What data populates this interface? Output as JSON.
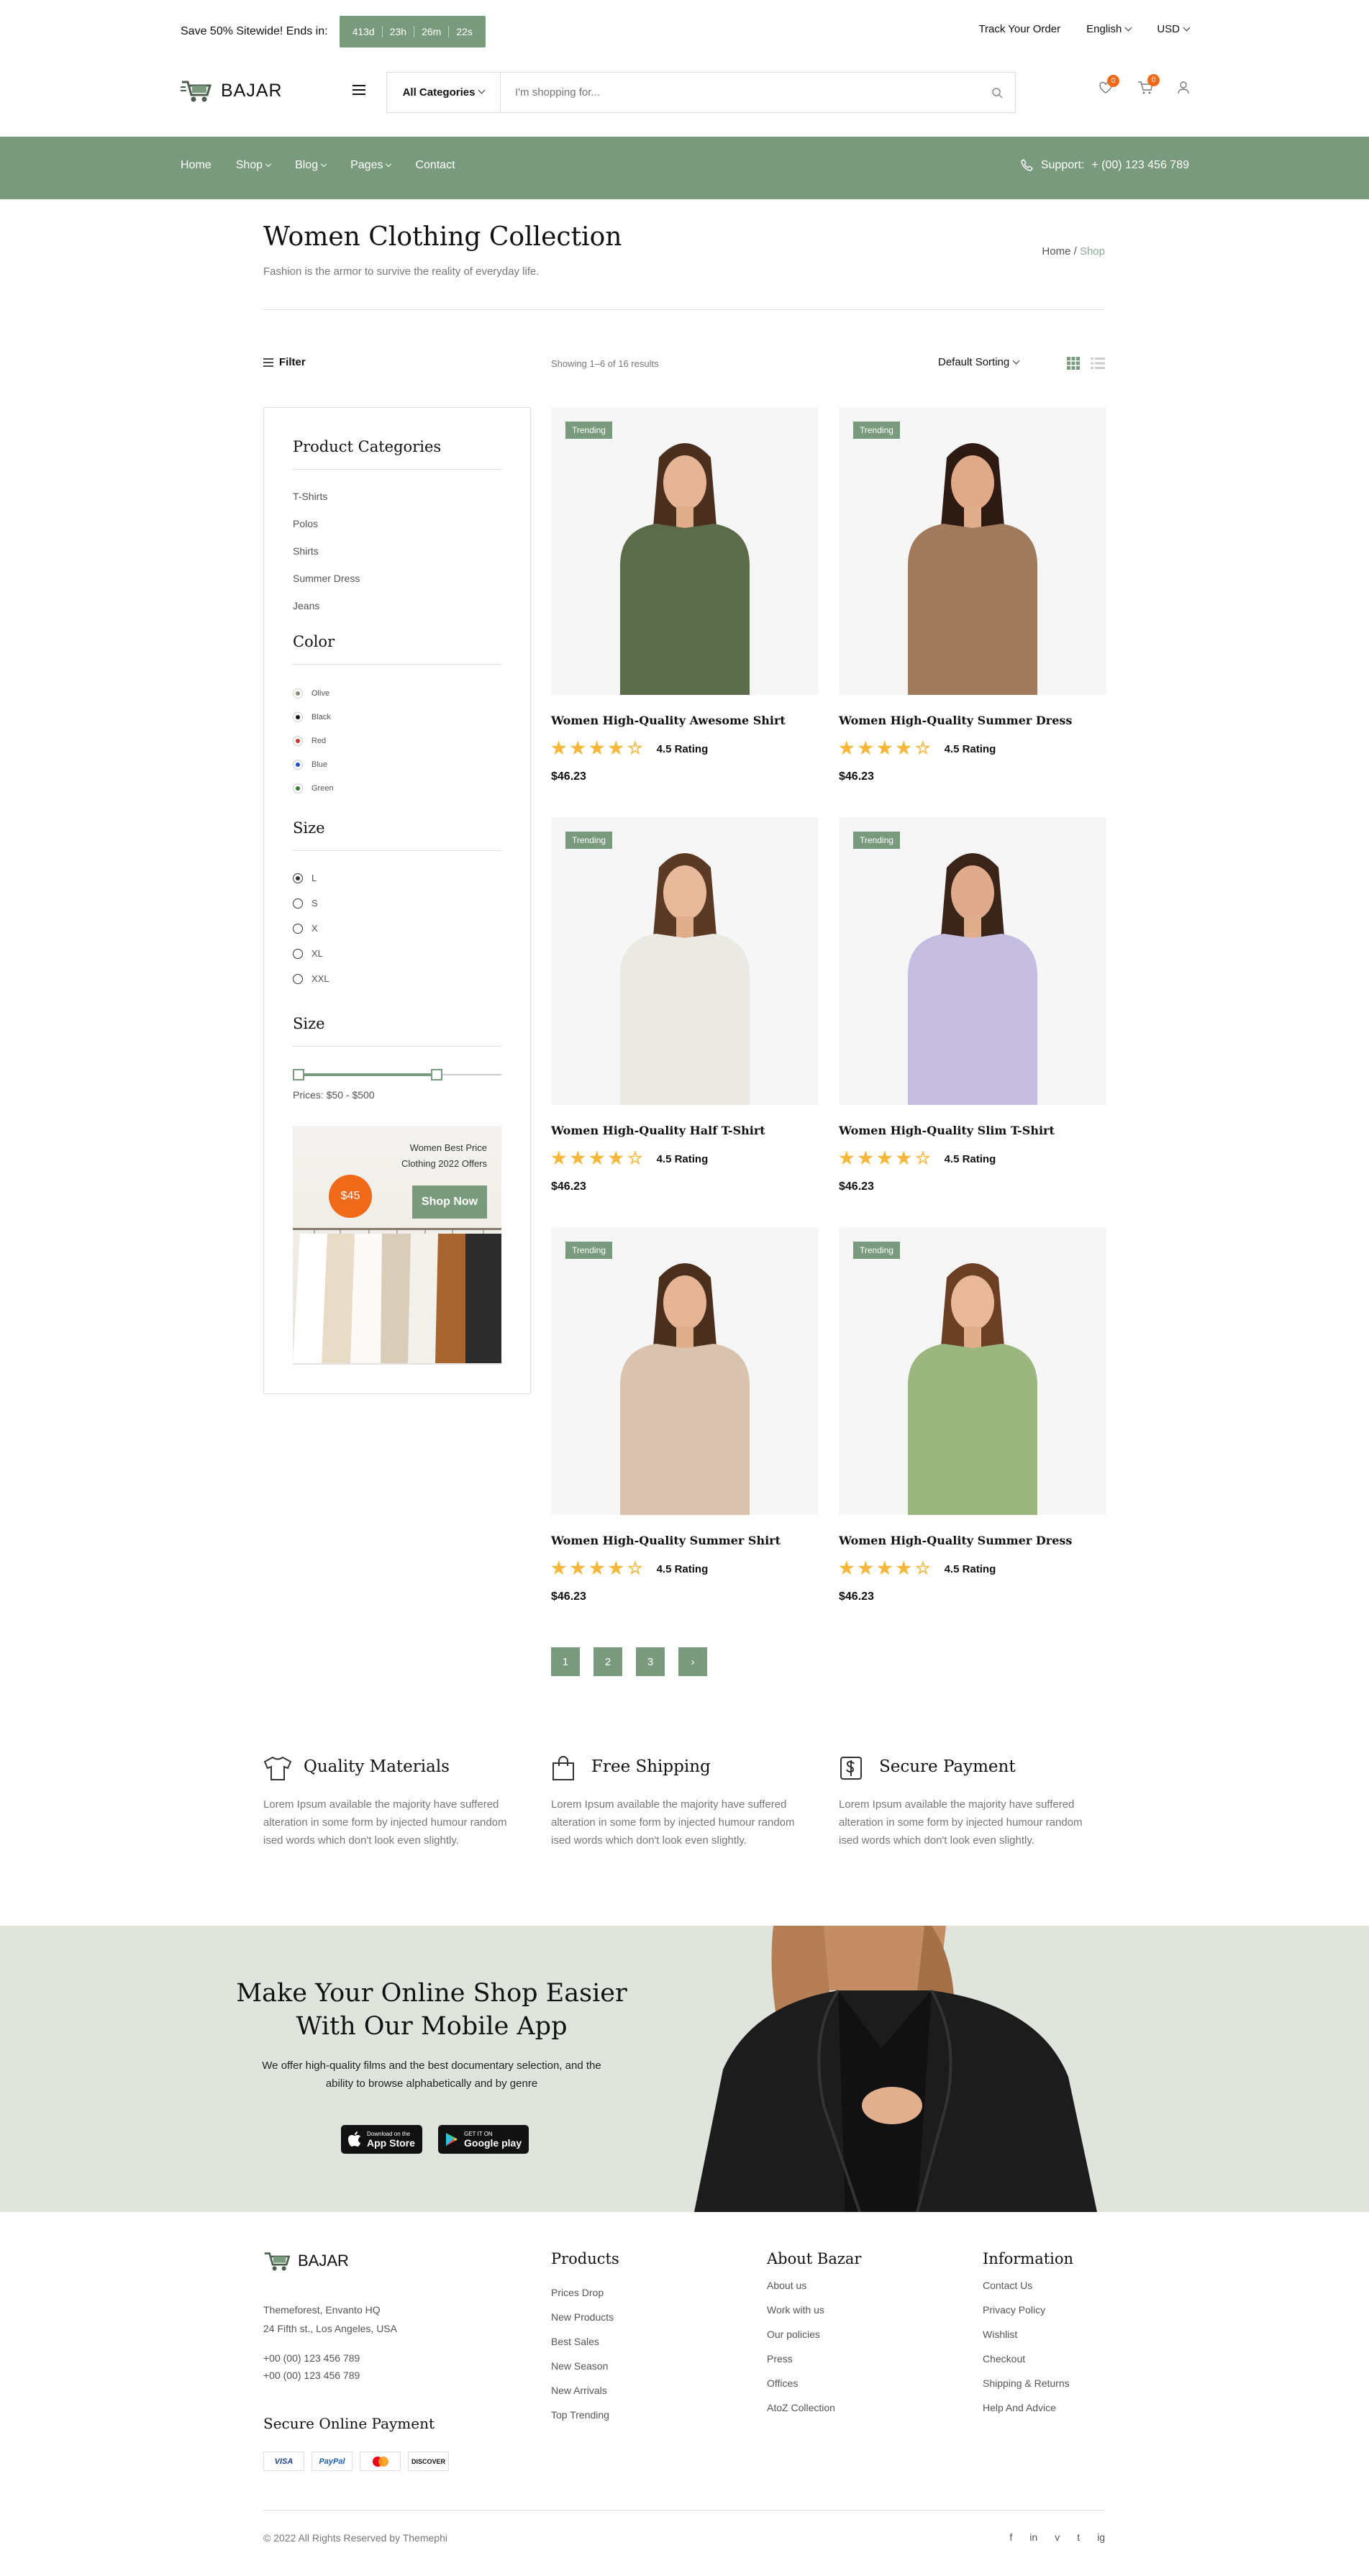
{
  "topbar": {
    "promo": "Save 50% Sitewide! Ends in:",
    "countdown": [
      "413d",
      "23h",
      "26m",
      "22s"
    ],
    "track_order": "Track Your Order",
    "language": "English",
    "currency": "USD"
  },
  "header": {
    "logo_text": "BAJAR",
    "search_category": "All Categories",
    "search_placeholder": "I'm shopping for...",
    "wishlist_count": "0",
    "cart_count": "0"
  },
  "nav": {
    "items": [
      "Home",
      "Shop",
      "Blog",
      "Pages",
      "Contact"
    ],
    "support_label": "Support:",
    "support_phone": "+ (00) 123 456 789"
  },
  "hero": {
    "title": "Women Clothing Collection",
    "subtitle": "Fashion is the armor to survive the reality of everyday life.",
    "crumb_home": "Home",
    "crumb_sep": "/",
    "crumb_current": "Shop"
  },
  "toolbar": {
    "filter": "Filter",
    "results": "Showing 1–6 of 16 results",
    "sorting": "Default Sorting"
  },
  "sidebar": {
    "categories_title": "Product Categories",
    "categories": [
      "T-Shirts",
      "Polos",
      "Shirts",
      "Summer Dress",
      "Jeans"
    ],
    "color_title": "Color",
    "colors": [
      {
        "name": "Olive",
        "hex": "#8a8f6a"
      },
      {
        "name": "Black",
        "hex": "#111111"
      },
      {
        "name": "Red",
        "hex": "#d32f2f"
      },
      {
        "name": "Blue",
        "hex": "#1f4fd8"
      },
      {
        "name": "Green",
        "hex": "#2e7d32"
      }
    ],
    "size_title": "Size",
    "sizes": [
      "L",
      "S",
      "X",
      "XL",
      "XXL"
    ],
    "selected_size": "L",
    "price_title": "Size",
    "price_label": "Prices: $50 - $500",
    "price_min": 50,
    "price_max": 500,
    "banner_line1": "Women Best Price",
    "banner_line2": "Clothing 2022 Offers",
    "banner_price": "$45",
    "banner_button": "Shop Now"
  },
  "products": [
    {
      "badge": "Trending",
      "name": "Women High-Quality Awesome Shirt",
      "rating": "4.5 Rating",
      "price": "$46.23",
      "stars": 4.5
    },
    {
      "badge": "Trending",
      "name": "Women High-Quality Summer Dress",
      "rating": "4.5 Rating",
      "price": "$46.23",
      "stars": 4.5
    },
    {
      "badge": "Trending",
      "name": "Women High-Quality Half T-Shirt",
      "rating": "4.5 Rating",
      "price": "$46.23",
      "stars": 4.5
    },
    {
      "badge": "Trending",
      "name": "Women High-Quality Slim T-Shirt",
      "rating": "4.5 Rating",
      "price": "$46.23",
      "stars": 4.5
    },
    {
      "badge": "Trending",
      "name": "Women High-Quality Summer Shirt",
      "rating": "4.5 Rating",
      "price": "$46.23",
      "stars": 4.5
    },
    {
      "badge": "Trending",
      "name": "Women High-Quality Summer Dress",
      "rating": "4.5 Rating",
      "price": "$46.23",
      "stars": 4.5
    }
  ],
  "pagination": [
    "1",
    "2",
    "3",
    "›"
  ],
  "features": [
    {
      "title": "Quality Materials",
      "text": "Lorem Ipsum available the majority have suffered alteration in some form by injected humour random ised words which don't look even slightly."
    },
    {
      "title": "Free Shipping",
      "text": "Lorem Ipsum available the majority have suffered alteration in some form by injected humour random ised words which don't look even slightly."
    },
    {
      "title": "Secure Payment",
      "text": "Lorem Ipsum available the majority have suffered alteration in some form by injected humour random ised words which don't look even slightly."
    }
  ],
  "app": {
    "title_line1": "Make Your Online Shop Easier",
    "title_line2": "With Our Mobile App",
    "text": "We offer high-quality films and the best documentary selection, and the ability to browse alphabetically and by genre",
    "appstore_small": "Download on the",
    "appstore": "App Store",
    "gplay_small": "GET IT ON",
    "gplay": "Google play"
  },
  "footer": {
    "logo_text": "BAJAR",
    "address1": "Themeforest, Envanto HQ",
    "address2": "24 Fifth st., Los Angeles, USA",
    "phone1": "+00 (00) 123 456 789",
    "phone2": "+00 (00) 123 456 789",
    "payment_title": "Secure Online Payment",
    "payments": [
      "VISA",
      "PayPal",
      "MC",
      "DISCOVER"
    ],
    "col1_title": "Products",
    "col1": [
      "Prices Drop",
      "New Products",
      "Best Sales",
      "New Season",
      "New Arrivals",
      "Top Trending"
    ],
    "col2_title": "About Bazar",
    "col2": [
      "About us",
      "Work with us",
      "Our policies",
      "Press",
      "Offices",
      "AtoZ Collection"
    ],
    "col3_title": "Information",
    "col3": [
      "Contact Us",
      "Privacy Policy",
      "Wishlist",
      "Checkout",
      "Shipping & Returns",
      "Help And Advice"
    ],
    "copyright": "© 2022 All Rights Reserved by Themephi",
    "social": [
      "f",
      "in",
      "v",
      "t",
      "ig"
    ]
  }
}
